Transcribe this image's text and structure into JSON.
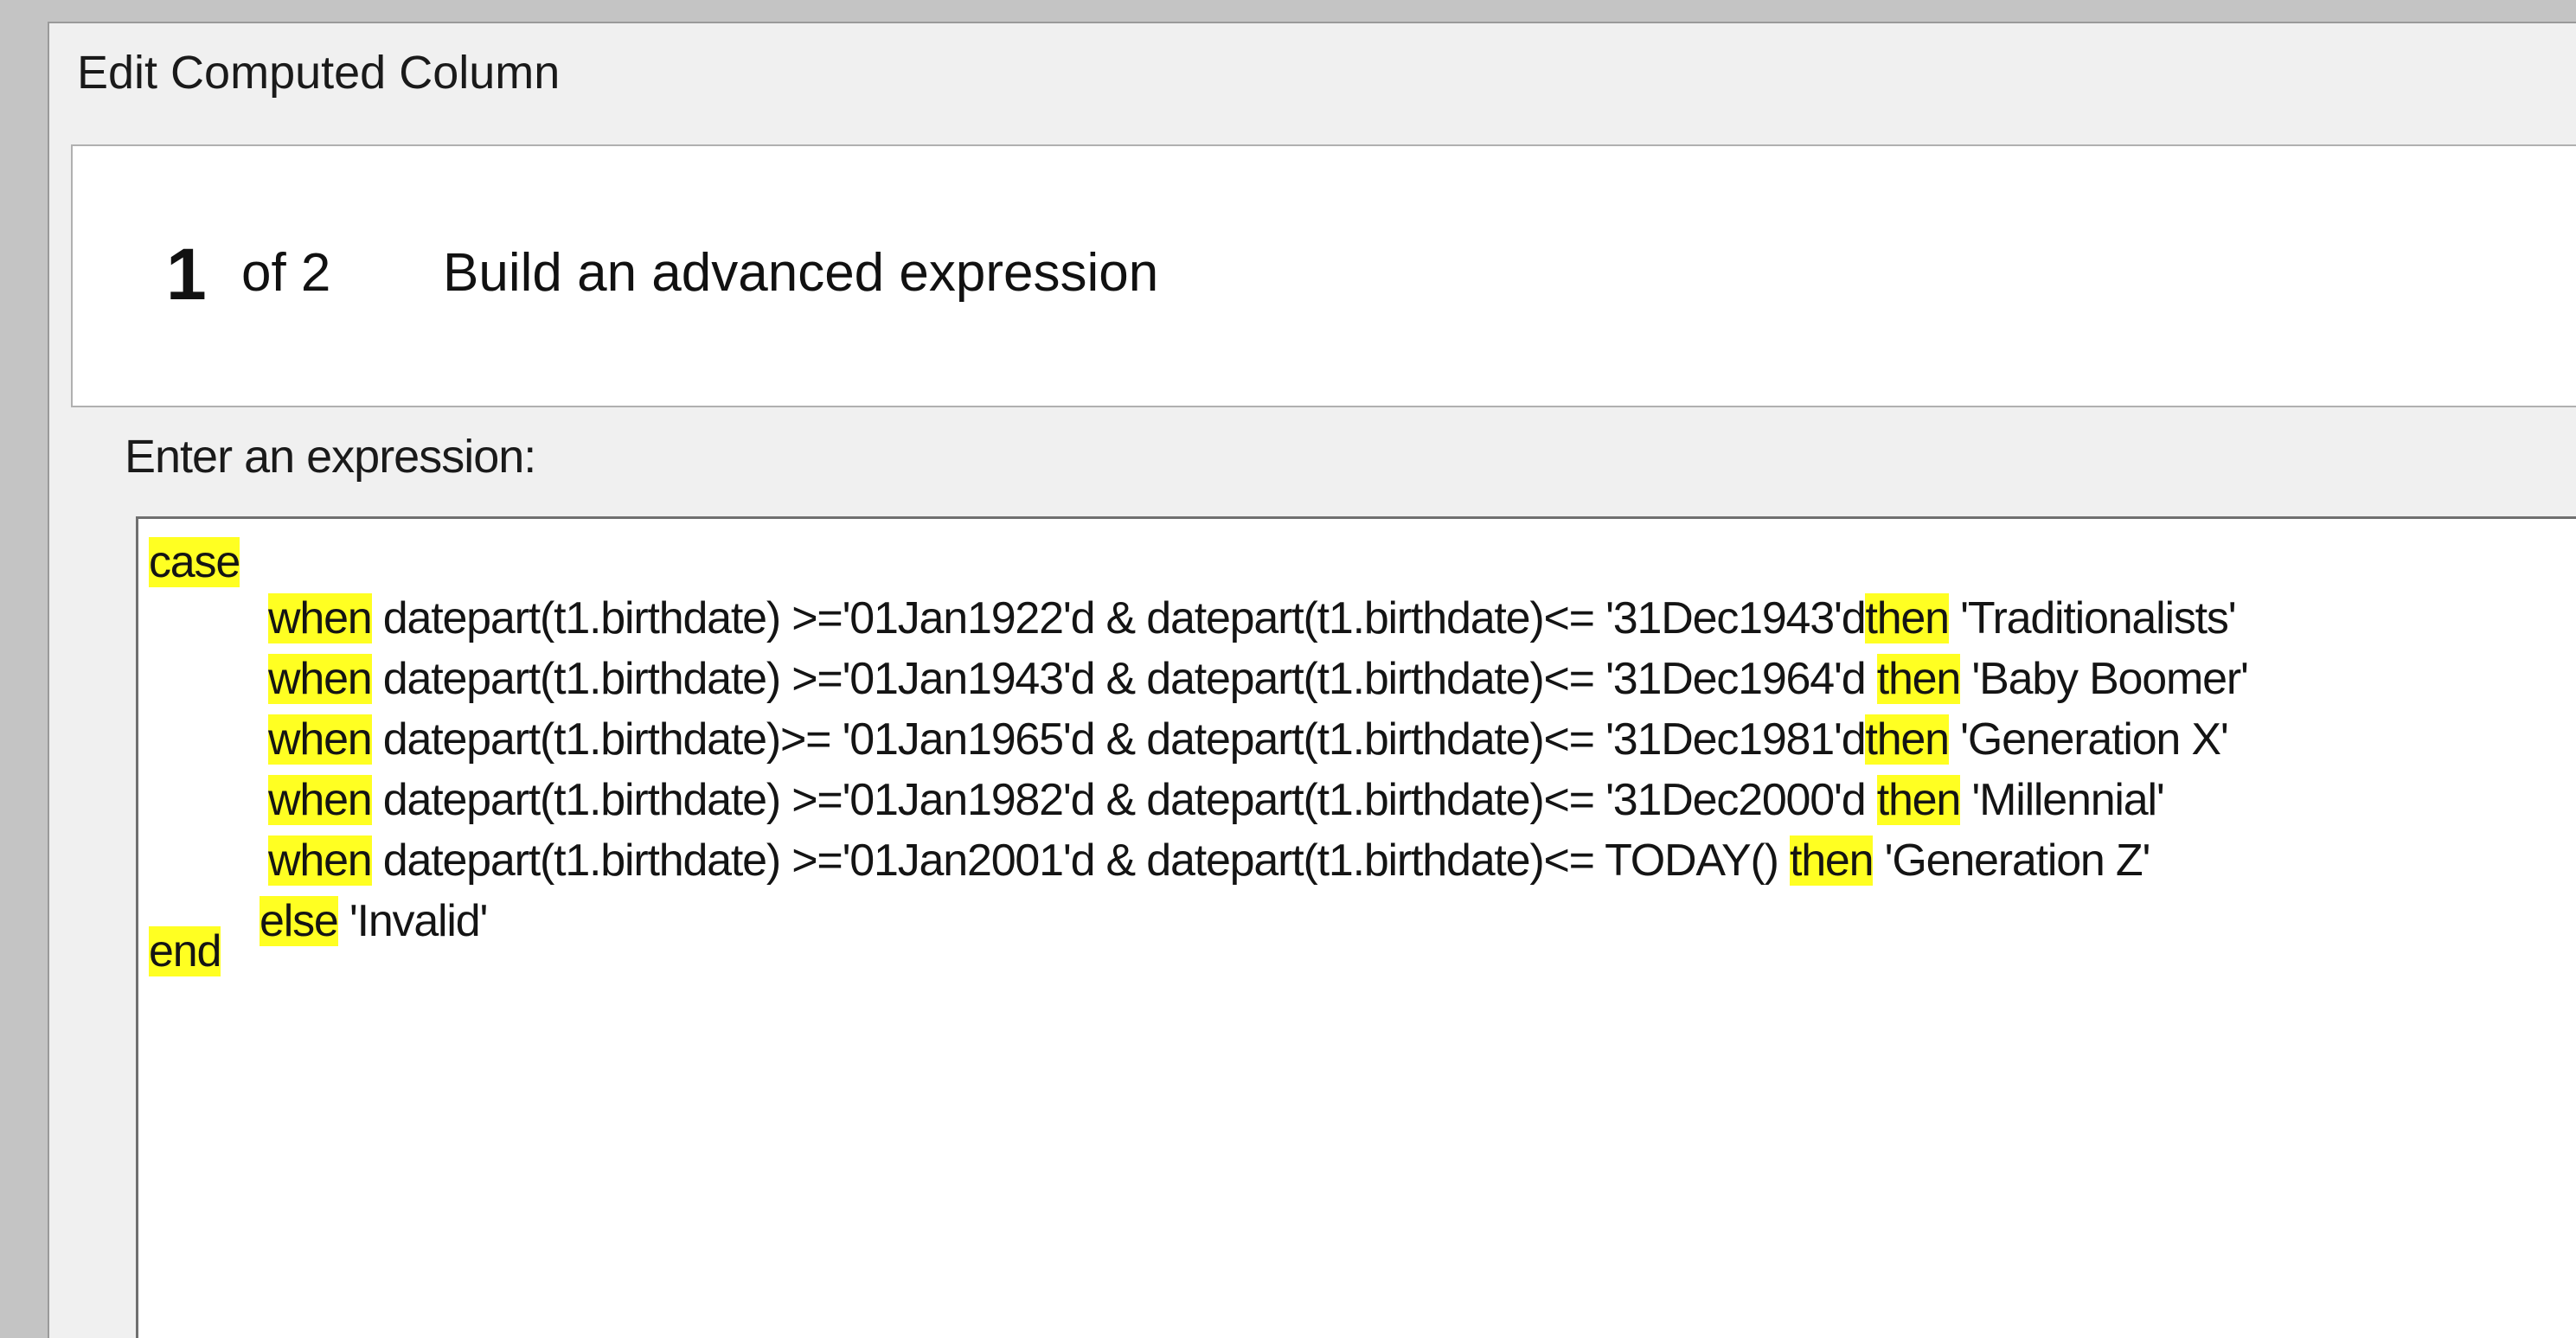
{
  "dialog": {
    "title": "Edit Computed Column"
  },
  "step": {
    "number": "1",
    "of_label": "of 2",
    "title": "Build an advanced expression"
  },
  "expression": {
    "label": "Enter an expression:",
    "lines": [
      {
        "kw1": "case"
      },
      {
        "kw1": "when",
        "body": " datepart(t1.birthdate) >='01Jan1922'd & datepart(t1.birthdate)<= '31Dec1943'd",
        "kw2": "then",
        "result": " 'Traditionalists'"
      },
      {
        "kw1": "when",
        "body": " datepart(t1.birthdate) >='01Jan1943'd & datepart(t1.birthdate)<= '31Dec1964'd ",
        "kw2": "then",
        "result": " 'Baby Boomer'"
      },
      {
        "kw1": "when",
        "body": " datepart(t1.birthdate)>= '01Jan1965'd & datepart(t1.birthdate)<= '31Dec1981'd",
        "kw2": "then",
        "result": " 'Generation X'"
      },
      {
        "kw1": "when",
        "body": " datepart(t1.birthdate) >='01Jan1982'd & datepart(t1.birthdate)<= '31Dec2000'd ",
        "kw2": "then",
        "result": " 'Millennial'"
      },
      {
        "kw1": "when",
        "body": " datepart(t1.birthdate) >='01Jan2001'd & datepart(t1.birthdate)<= TODAY() ",
        "kw2": "then",
        "result": " 'Generation Z'"
      },
      {
        "kw1": "else",
        "result": " 'Invalid'"
      },
      {
        "kw1": "end"
      }
    ]
  },
  "colors": {
    "highlight": "#ffff22",
    "dialog_bg": "#f0f0f0",
    "outer_bg": "#c4c4c4"
  }
}
